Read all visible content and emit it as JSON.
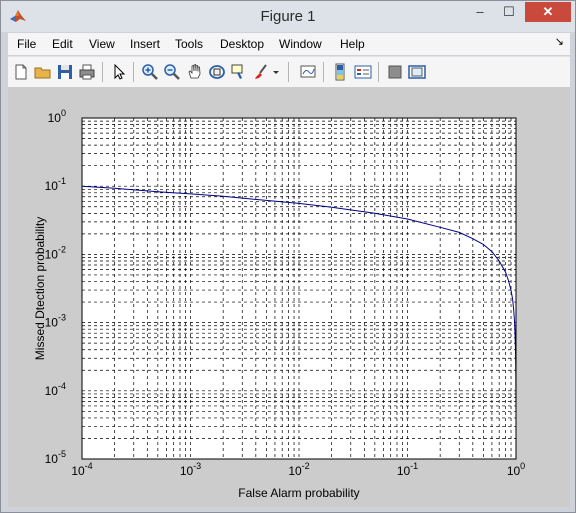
{
  "window": {
    "title": "Figure 1",
    "controls": {
      "minimize": "–",
      "maximize": "☐",
      "close": "✕"
    }
  },
  "menu": {
    "items": [
      "File",
      "Edit",
      "View",
      "Insert",
      "Tools",
      "Desktop",
      "Window",
      "Help"
    ],
    "dock_arrow": "↘"
  },
  "toolbar": {
    "buttons": [
      "new-figure-icon",
      "open-file-icon",
      "save-icon",
      "print-icon",
      "edit-plot-arrow-icon",
      "zoom-in-icon",
      "zoom-out-icon",
      "pan-hand-icon",
      "rotate-3d-icon",
      "data-cursor-icon",
      "brush-icon",
      "link-plot-icon",
      "colorbar-icon",
      "legend-icon",
      "hide-plot-tools-icon",
      "show-plot-tools-icon"
    ]
  },
  "colors": {
    "line": "#00008b",
    "figure_bg": "#cccccc",
    "axes_bg": "#ffffff"
  },
  "chart_data": {
    "type": "line",
    "title": "",
    "xlabel": "False Alarm probability",
    "ylabel": "Missed Dtection probability",
    "xscale": "log",
    "yscale": "log",
    "xlim": [
      0.0001,
      1
    ],
    "ylim": [
      1e-05,
      1
    ],
    "x_tick_labels": [
      {
        "base": "10",
        "exp": "-4"
      },
      {
        "base": "10",
        "exp": "-3"
      },
      {
        "base": "10",
        "exp": "-2"
      },
      {
        "base": "10",
        "exp": "-1"
      },
      {
        "base": "10",
        "exp": "0"
      }
    ],
    "y_tick_labels": [
      {
        "base": "10",
        "exp": "-5"
      },
      {
        "base": "10",
        "exp": "-4"
      },
      {
        "base": "10",
        "exp": "-3"
      },
      {
        "base": "10",
        "exp": "-2"
      },
      {
        "base": "10",
        "exp": "-1"
      },
      {
        "base": "10",
        "exp": "0"
      }
    ],
    "x_ticks": [
      0.0001,
      0.001,
      0.01,
      0.1,
      1
    ],
    "y_ticks": [
      1e-05,
      0.0001,
      0.001,
      0.01,
      0.1,
      1
    ],
    "grid": "major and minor, dashed",
    "series": [
      {
        "x": [
          0.0001,
          0.0002,
          0.0005,
          0.001,
          0.002,
          0.005,
          0.01,
          0.02,
          0.05,
          0.1,
          0.2,
          0.3,
          0.4,
          0.5,
          0.6,
          0.7,
          0.8,
          0.85,
          0.9,
          0.93,
          0.95,
          0.97,
          0.98,
          0.99,
          0.995,
          0.999,
          1
        ],
        "y": [
          0.1,
          0.093,
          0.083,
          0.077,
          0.071,
          0.062,
          0.056,
          0.049,
          0.04,
          0.033,
          0.025,
          0.021,
          0.017,
          0.014,
          0.011,
          0.008,
          0.0055,
          0.0042,
          0.003,
          0.0022,
          0.0016,
          0.001,
          0.0007,
          0.0004,
          0.0002,
          5e-05,
          1e-05
        ]
      }
    ]
  }
}
